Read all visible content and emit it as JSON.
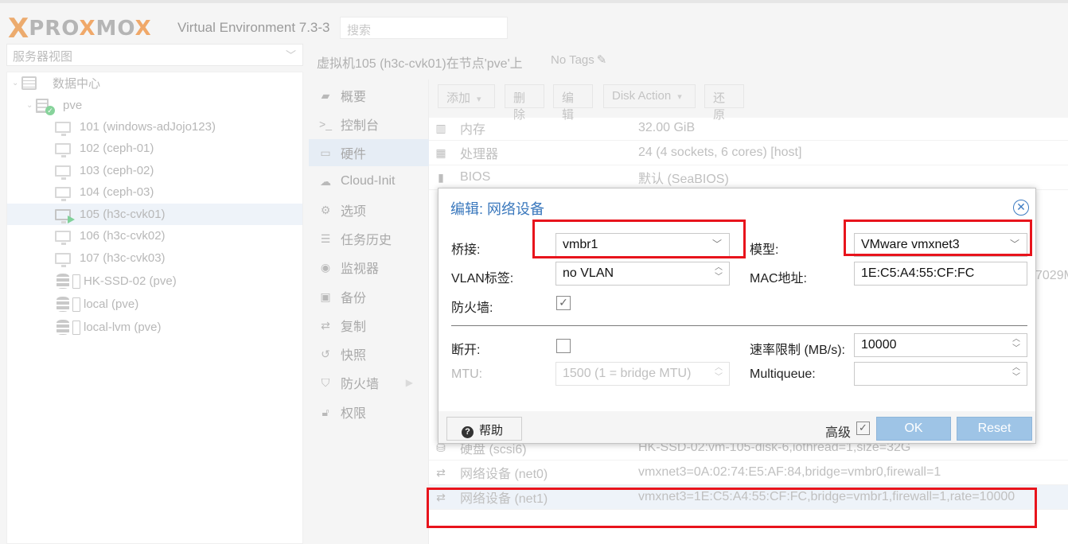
{
  "header": {
    "logo_x": "X",
    "logo_text_pre": "PRO",
    "logo_text_x": "X",
    "logo_text_post": "MO",
    "logo_x2": "X",
    "product": "Virtual Environment 7.3-3",
    "search_placeholder": "搜索"
  },
  "tree": {
    "view_selector": "服务器视图",
    "datacenter": "数据中心",
    "node": "pve",
    "vms": [
      {
        "label": "101 (windows-adJojo123)",
        "running": false
      },
      {
        "label": "102 (ceph-01)",
        "running": false
      },
      {
        "label": "103 (ceph-02)",
        "running": false
      },
      {
        "label": "104 (ceph-03)",
        "running": false
      },
      {
        "label": "105 (h3c-cvk01)",
        "running": true,
        "selected": true
      },
      {
        "label": "106 (h3c-cvk02)",
        "running": false
      },
      {
        "label": "107 (h3c-cvk03)",
        "running": false
      }
    ],
    "storages": [
      "HK-SSD-02 (pve)",
      "local (pve)",
      "local-lvm (pve)"
    ]
  },
  "vm_header": {
    "title": "虚拟机105 (h3c-cvk01)在节点'pve'上",
    "tags": "No Tags"
  },
  "nav": [
    {
      "label": "概要",
      "icon": "book-icon"
    },
    {
      "label": "控制台",
      "icon": "terminal-icon"
    },
    {
      "label": "硬件",
      "icon": "desktop-icon",
      "selected": true
    },
    {
      "label": "Cloud-Init",
      "icon": "cloud-icon"
    },
    {
      "label": "选项",
      "icon": "gear-icon"
    },
    {
      "label": "任务历史",
      "icon": "list-icon"
    },
    {
      "label": "监视器",
      "icon": "eye-icon"
    },
    {
      "label": "备份",
      "icon": "floppy-icon"
    },
    {
      "label": "复制",
      "icon": "retweet-icon"
    },
    {
      "label": "快照",
      "icon": "history-icon"
    },
    {
      "label": "防火墙",
      "icon": "shield-icon",
      "has_submenu": true
    },
    {
      "label": "权限",
      "icon": "unlock-icon"
    }
  ],
  "toolbar": {
    "add": "添加",
    "remove": "删除",
    "edit": "编辑",
    "disk_action": "Disk Action",
    "revert": "还原"
  },
  "hardware": [
    {
      "name": "内存",
      "value": "32.00 GiB",
      "icon": "memory-icon"
    },
    {
      "name": "处理器",
      "value": "24 (4 sockets, 6 cores) [host]",
      "icon": "cpu-icon"
    },
    {
      "name": "BIOS",
      "value": "默认 (SeaBIOS)",
      "icon": "microchip-icon"
    }
  ],
  "hardware_partial": "7029M",
  "hardware_bottom": [
    {
      "name": "硬盘 (scsi6)",
      "value": "HK-SSD-02:vm-105-disk-6,iothread=1,size=32G",
      "icon": "hdd-icon"
    },
    {
      "name": "网络设备 (net0)",
      "value": "vmxnet3=0A:02:74:E5:AF:84,bridge=vmbr0,firewall=1",
      "icon": "exchange-icon"
    },
    {
      "name": "网络设备 (net1)",
      "value": "vmxnet3=1E:C5:A4:55:CF:FC,bridge=vmbr1,firewall=1,rate=10000",
      "icon": "exchange-icon",
      "selected": true
    }
  ],
  "dialog": {
    "title": "编辑: 网络设备",
    "bridge_label": "桥接:",
    "bridge_value": "vmbr1",
    "model_label": "模型:",
    "model_value": "VMware vmxnet3",
    "vlan_label": "VLAN标签:",
    "vlan_value": "no VLAN",
    "mac_label": "MAC地址:",
    "mac_value": "1E:C5:A4:55:CF:FC",
    "firewall_label": "防火墙:",
    "firewall_checked": true,
    "disconnect_label": "断开:",
    "disconnect_checked": false,
    "rate_label": "速率限制 (MB/s):",
    "rate_value": "10000",
    "mtu_label": "MTU:",
    "mtu_value": "1500 (1 = bridge MTU)",
    "multiqueue_label": "Multiqueue:",
    "multiqueue_value": "",
    "help": "帮助",
    "advanced_label": "高级",
    "advanced_checked": true,
    "ok": "OK",
    "reset": "Reset"
  },
  "colors": {
    "accent": "#3a78bd",
    "highlight": "#e8141c",
    "button_blue": "#9ec4e6",
    "logo_orange": "#e57000"
  }
}
